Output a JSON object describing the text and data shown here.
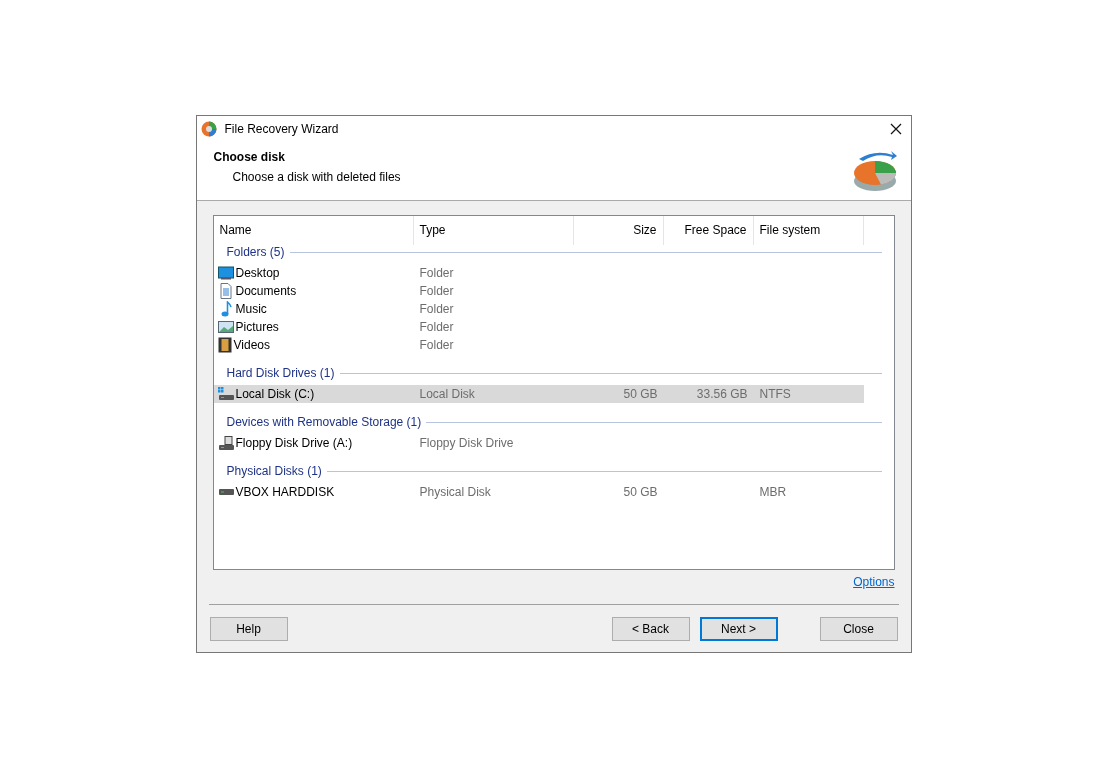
{
  "window": {
    "title": "File Recovery Wizard"
  },
  "header": {
    "title": "Choose disk",
    "subtitle": "Choose a disk with deleted files"
  },
  "table": {
    "columns": [
      "Name",
      "Type",
      "Size",
      "Free Space",
      "File system"
    ],
    "groups": [
      {
        "title": "Folders (5)",
        "rows": [
          {
            "kind": "desktop",
            "selected": false,
            "cells": [
              "Desktop",
              "Folder",
              "",
              "",
              ""
            ]
          },
          {
            "kind": "documents",
            "selected": false,
            "cells": [
              "Documents",
              "Folder",
              "",
              "",
              ""
            ]
          },
          {
            "kind": "music",
            "selected": false,
            "cells": [
              "Music",
              "Folder",
              "",
              "",
              ""
            ]
          },
          {
            "kind": "pictures",
            "selected": false,
            "cells": [
              "Pictures",
              "Folder",
              "",
              "",
              ""
            ]
          },
          {
            "kind": "videos",
            "selected": false,
            "cells": [
              "Videos",
              "Folder",
              "",
              "",
              ""
            ]
          }
        ]
      },
      {
        "title": "Hard Disk Drives (1)",
        "rows": [
          {
            "kind": "system-disk",
            "selected": true,
            "cells": [
              "Local Disk (C:)",
              "Local Disk",
              "50 GB",
              "33.56 GB",
              "NTFS"
            ]
          }
        ]
      },
      {
        "title": "Devices with Removable Storage (1)",
        "rows": [
          {
            "kind": "floppy",
            "selected": false,
            "cells": [
              "Floppy Disk Drive (A:)",
              "Floppy Disk Drive",
              "",
              "",
              ""
            ]
          }
        ]
      },
      {
        "title": "Physical Disks (1)",
        "rows": [
          {
            "kind": "disk",
            "selected": false,
            "cells": [
              "VBOX HARDDISK",
              "Physical Disk",
              "50 GB",
              "",
              "MBR"
            ]
          }
        ]
      }
    ]
  },
  "options_link": "Options",
  "buttons": [
    {
      "label": "Help",
      "focused": false
    },
    {
      "label": "< Back",
      "focused": false
    },
    {
      "label": "Next >",
      "focused": true
    },
    {
      "label": "Close",
      "focused": false
    }
  ]
}
